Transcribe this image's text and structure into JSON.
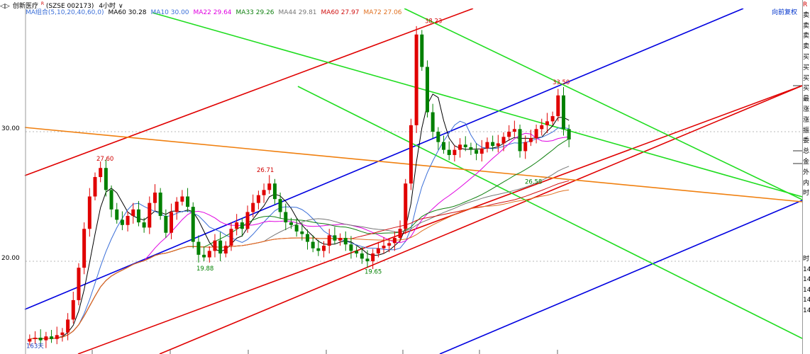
{
  "header": {
    "nav_prev": "◁▷",
    "stock_name": "创新医疗",
    "rights": "R",
    "code": "(SZSE 002173)",
    "period": "4小时",
    "period_arrow": "∨",
    "ma_group": "MA组合(5,10,20,40,60,0)",
    "adjust_label": "向前复权",
    "ma_values": [
      {
        "label": "MA60 30.28",
        "color": "#000000"
      },
      {
        "label": "MA10 30.00",
        "color": "#3b6fd8"
      },
      {
        "label": "MA22 29.64",
        "color": "#e000e0"
      },
      {
        "label": "MA33 29.26",
        "color": "#108010"
      },
      {
        "label": "MA44 29.81",
        "color": "#777777"
      },
      {
        "label": "MA60 27.97",
        "color": "#d01010"
      },
      {
        "label": "MA72 27.06",
        "color": "#e07020"
      }
    ]
  },
  "right_panel": {
    "top_mark": "R",
    "labels": [
      "卖",
      "卖",
      "卖",
      "卖",
      "买",
      "买",
      "买",
      "买",
      "最",
      "涨",
      "涨",
      "振",
      "委",
      "总",
      "金",
      "外",
      "内",
      "时"
    ],
    "bottom_labels": [
      "时",
      "14",
      "14",
      "14",
      "14",
      "14"
    ]
  },
  "chart_data": {
    "type": "candlestick",
    "y_ticks": [
      {
        "label": "30.00",
        "value": 30.0
      },
      {
        "label": "20.00",
        "value": 20.0
      }
    ],
    "ylim": [
      13.0,
      40.0
    ],
    "annotations": [
      {
        "text": "27.60",
        "value": 27.6,
        "kind": "high"
      },
      {
        "text": "26.71",
        "value": 26.71,
        "kind": "high"
      },
      {
        "text": "38.23",
        "value": 38.23,
        "kind": "high"
      },
      {
        "text": "33.50",
        "value": 33.5,
        "kind": "high"
      },
      {
        "text": "19.88",
        "value": 19.88,
        "kind": "low"
      },
      {
        "text": "19.65",
        "value": 19.65,
        "kind": "low"
      },
      {
        "text": "26.58",
        "value": 26.58,
        "kind": "low"
      },
      {
        "text": "163天",
        "value": 13.3,
        "kind": "count"
      }
    ],
    "close_path": [
      14.0,
      14.1,
      13.9,
      14.2,
      14.0,
      14.3,
      14.5,
      15.5,
      17.0,
      19.5,
      22.5,
      25.0,
      26.5,
      27.2,
      25.5,
      24.0,
      23.2,
      22.8,
      23.5,
      24.0,
      23.0,
      22.6,
      24.5,
      25.3,
      23.5,
      22.2,
      23.8,
      24.6,
      25.0,
      24.2,
      21.5,
      20.5,
      20.3,
      20.8,
      21.6,
      20.6,
      21.2,
      22.5,
      23.0,
      22.5,
      23.8,
      24.5,
      25.1,
      25.5,
      26.0,
      24.8,
      23.8,
      23.0,
      22.8,
      22.3,
      22.1,
      21.5,
      21.0,
      20.8,
      21.2,
      22.0,
      21.6,
      21.8,
      21.3,
      20.8,
      20.6,
      20.2,
      20.0,
      20.6,
      21.0,
      21.2,
      21.4,
      21.8,
      22.5,
      26.0,
      30.5,
      37.5,
      35.0,
      31.5,
      30.0,
      29.2,
      28.6,
      28.2,
      28.6,
      29.0,
      28.8,
      28.6,
      28.3,
      28.7,
      29.2,
      28.9,
      29.1,
      29.6,
      30.0,
      30.2,
      28.5,
      29.2,
      29.5,
      30.2,
      30.5,
      30.8,
      31.2,
      32.8,
      30.2,
      29.4
    ],
    "ma_lines": [
      {
        "label": "MA5",
        "color": "#000000",
        "window": 5
      },
      {
        "label": "MA10",
        "color": "#3b6fd8",
        "window": 10
      },
      {
        "label": "MA22",
        "color": "#e000e0",
        "window": 22
      },
      {
        "label": "MA33",
        "color": "#108010",
        "window": 33
      },
      {
        "label": "MA44",
        "color": "#777777",
        "window": 44
      },
      {
        "label": "MA60",
        "color": "#d01010",
        "window": 60
      },
      {
        "label": "MA72",
        "color": "#e07020",
        "window": 72
      }
    ],
    "trendline_colors": {
      "red": "#e00000",
      "blue": "#0000e0",
      "green": "#20dd20",
      "orange": "#f08010"
    },
    "up_color": "#e00000",
    "down_color": "#008000",
    "grid": "dotted",
    "legend": "top-left"
  }
}
